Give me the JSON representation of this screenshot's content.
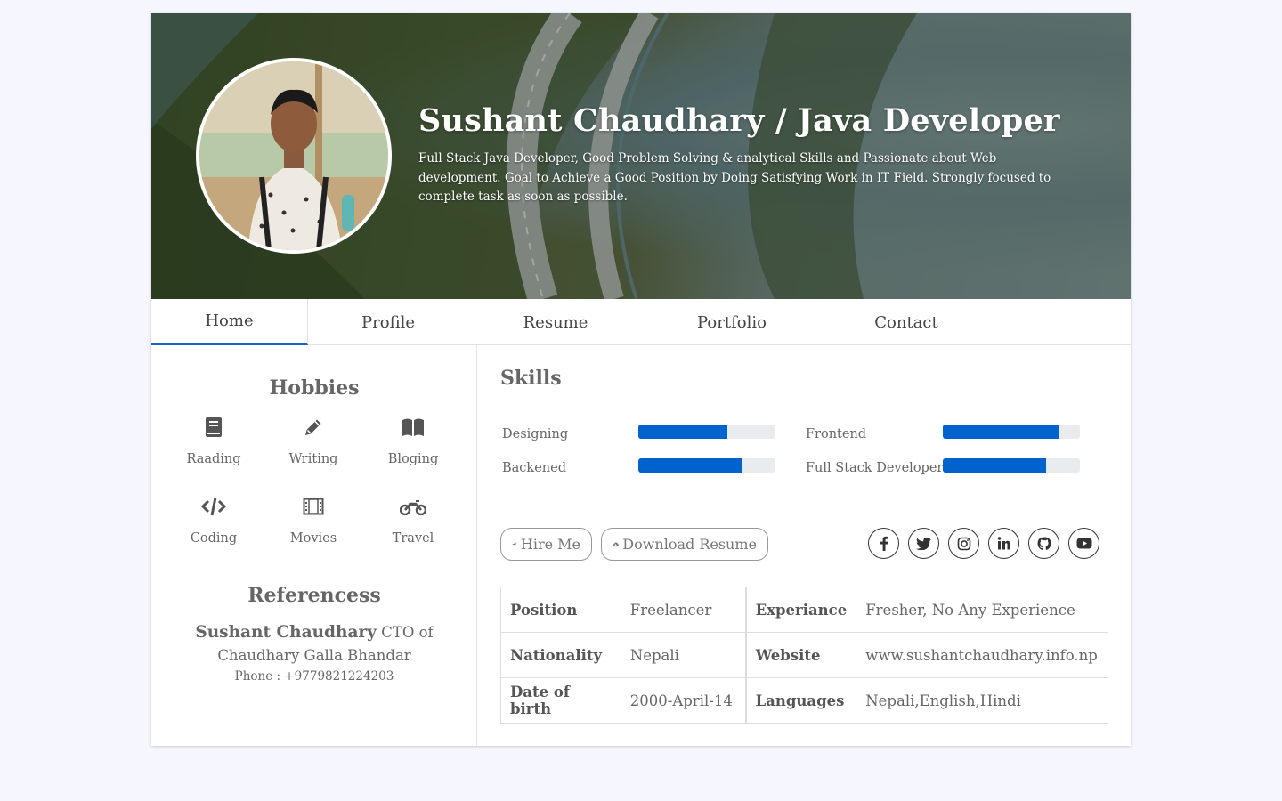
{
  "header": {
    "name": "Sushant Chaudhary / Java Developer",
    "description": "Full Stack Java Developer, Good Problem Solving & analytical Skills and Passionate about Web development. Goal to Achieve a Good Position by Doing Satisfying Work in IT Field. Strongly focused to complete task as soon as possible."
  },
  "tabs": [
    {
      "label": "Home",
      "active": true
    },
    {
      "label": "Profile"
    },
    {
      "label": "Resume"
    },
    {
      "label": "Portfolio"
    },
    {
      "label": "Contact"
    }
  ],
  "hobbies": {
    "title": "Hobbies",
    "items": [
      {
        "label": "Raading",
        "icon": "book-icon"
      },
      {
        "label": "Writing",
        "icon": "pencil-icon"
      },
      {
        "label": "Bloging",
        "icon": "open-book-icon"
      },
      {
        "label": "Coding",
        "icon": "code-icon"
      },
      {
        "label": "Movies",
        "icon": "film-icon"
      },
      {
        "label": "Travel",
        "icon": "motorcycle-icon"
      }
    ]
  },
  "references": {
    "title": "Referencess",
    "name": "Sushant Chaudhary",
    "role": "CTO of Chaudhary Galla Bhandar",
    "phone": "Phone : +9779821224203"
  },
  "skills": {
    "title": "Skills",
    "items": [
      {
        "name": "Designing",
        "level": 0.65
      },
      {
        "name": "Frontend",
        "level": 0.85
      },
      {
        "name": "Backened",
        "level": 0.75
      },
      {
        "name": "Full Stack Developer",
        "level": 0.75
      }
    ]
  },
  "buttons": {
    "hire": "Hire Me",
    "download": "Download Resume"
  },
  "social": [
    "facebook-icon",
    "twitter-icon",
    "instagram-icon",
    "linkedin-icon",
    "github-icon",
    "youtube-icon"
  ],
  "info": {
    "position_label": "Position",
    "position": "Freelancer",
    "experience_label": "Experiance",
    "experience": "Fresher, No Any Experience",
    "nationality_label": "Nationality",
    "nationality": "Nepali",
    "website_label": "Website",
    "website": "www.sushantchaudhary.info.np",
    "dob_label": "Date of birth",
    "dob": "2000-April-14",
    "languages_label": "Languages",
    "languages": "Nepali,English,Hindi"
  },
  "colors": {
    "accent": "#1d63c9",
    "progress": "#0062cc",
    "background": "#f5f6fe"
  }
}
